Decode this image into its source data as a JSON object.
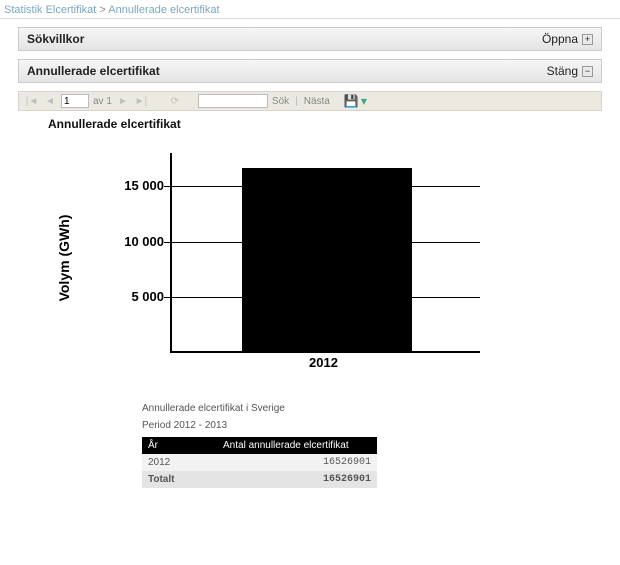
{
  "breadcrumb": {
    "root": "Statistik Elcertifikat",
    "sep": ">",
    "current": "Annullerade elcertifikat"
  },
  "panel_search": {
    "title": "Sökvillkor",
    "toggle": "Öppna"
  },
  "panel_report": {
    "title": "Annullerade elcertifikat",
    "toggle": "Stäng"
  },
  "toolbar": {
    "page_value": "1",
    "of_label": "av 1",
    "search_placeholder": "",
    "search_label": "Sök",
    "next_label": "Nästa"
  },
  "report": {
    "title": "Annullerade elcertifikat",
    "subtitle1": "Annullerade elcertifikat i Sverige",
    "subtitle2": "Period 2012 - 2013"
  },
  "table": {
    "headers": [
      "År",
      "Antal annullerade elcertifikat"
    ],
    "rows": [
      {
        "year": "2012",
        "value": "16526901"
      }
    ],
    "total_label": "Totalt",
    "total_value": "16526901"
  },
  "chart_data": {
    "type": "bar",
    "title": "Annullerade elcertifikat",
    "xlabel": "",
    "ylabel": "Volym (GWh)",
    "categories": [
      "2012"
    ],
    "values": [
      16500
    ],
    "yticks": [
      5000,
      10000,
      15000
    ],
    "ytick_labels": [
      "5 000",
      "10 000",
      "15 000"
    ],
    "ylim": [
      0,
      18000
    ]
  }
}
